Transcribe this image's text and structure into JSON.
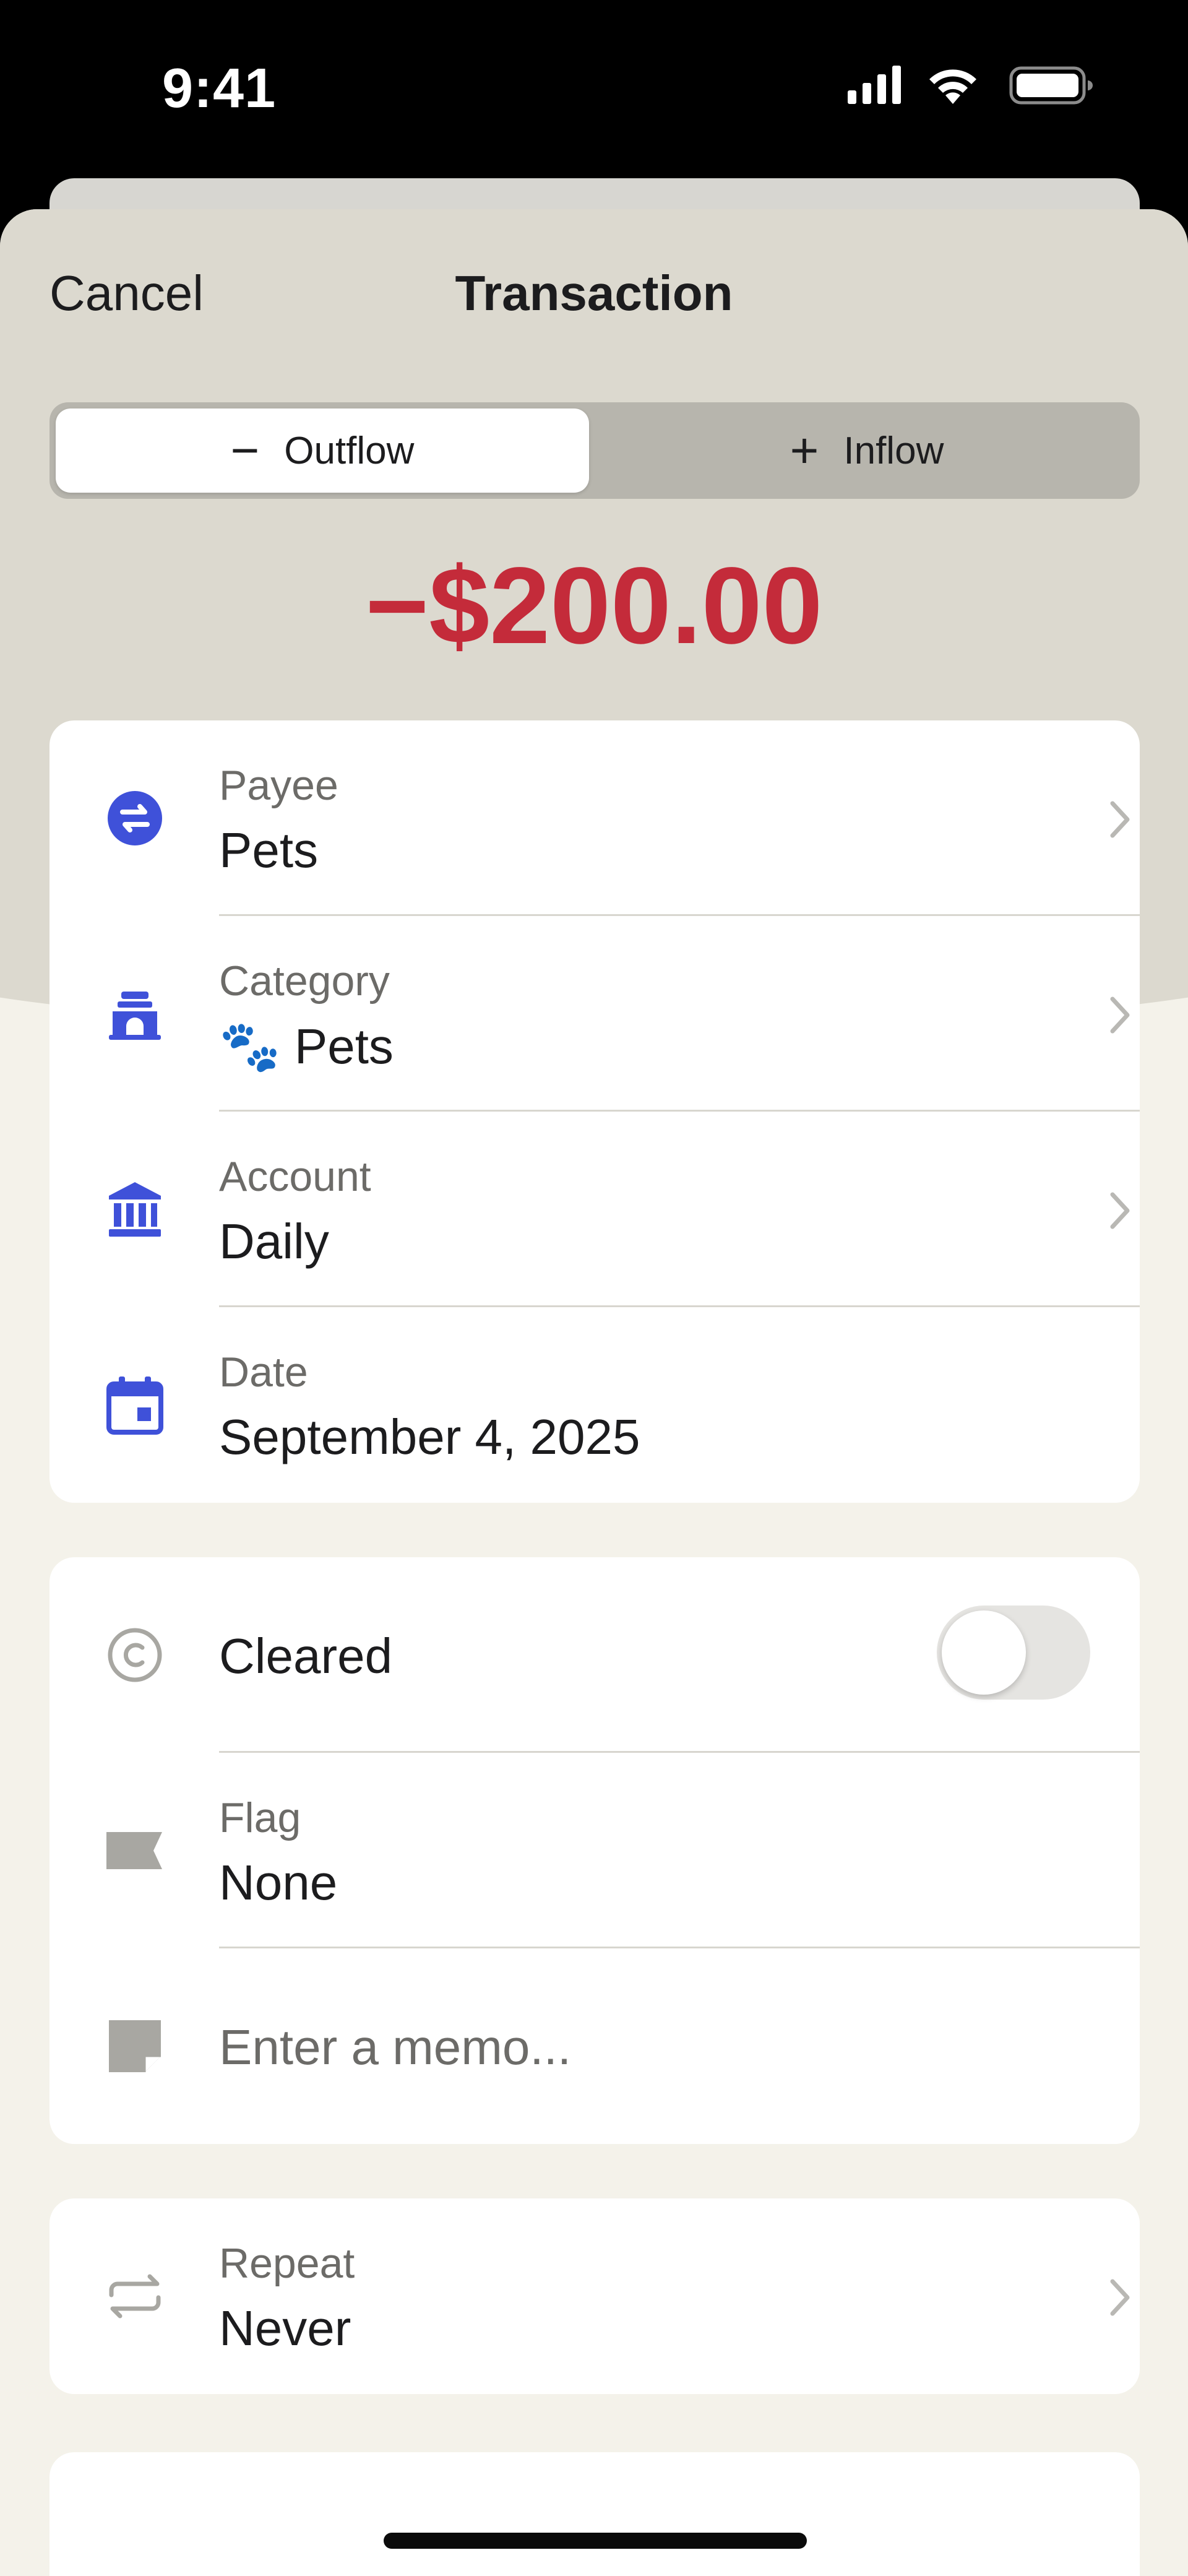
{
  "status_bar": {
    "time": "9:41"
  },
  "nav": {
    "cancel_label": "Cancel",
    "title": "Transaction"
  },
  "flow_toggle": {
    "outflow_label": "Outflow",
    "inflow_label": "Inflow",
    "selected": "Outflow"
  },
  "amount": {
    "display": "−$200.00",
    "color": "#c42b3a"
  },
  "details": {
    "payee": {
      "label": "Payee",
      "value": "Pets",
      "icon": "transfer-icon"
    },
    "category": {
      "label": "Category",
      "emoji": "🐾",
      "value": "Pets",
      "icon": "pet-bed-icon"
    },
    "account": {
      "label": "Account",
      "value": "Daily",
      "icon": "bank-icon"
    },
    "date": {
      "label": "Date",
      "value": "September 4, 2025",
      "icon": "calendar-icon"
    }
  },
  "status": {
    "cleared": {
      "label": "Cleared",
      "on": false,
      "icon": "cleared-icon"
    },
    "flag": {
      "label": "Flag",
      "value": "None",
      "icon": "flag-icon"
    },
    "memo": {
      "placeholder": "Enter a memo...",
      "icon": "note-icon"
    }
  },
  "repeat": {
    "label": "Repeat",
    "value": "Never",
    "icon": "repeat-icon"
  },
  "colors": {
    "accent": "#3f51d9",
    "sheet_bg": "#f4f2ea",
    "header_bg": "#dcd9cf"
  }
}
